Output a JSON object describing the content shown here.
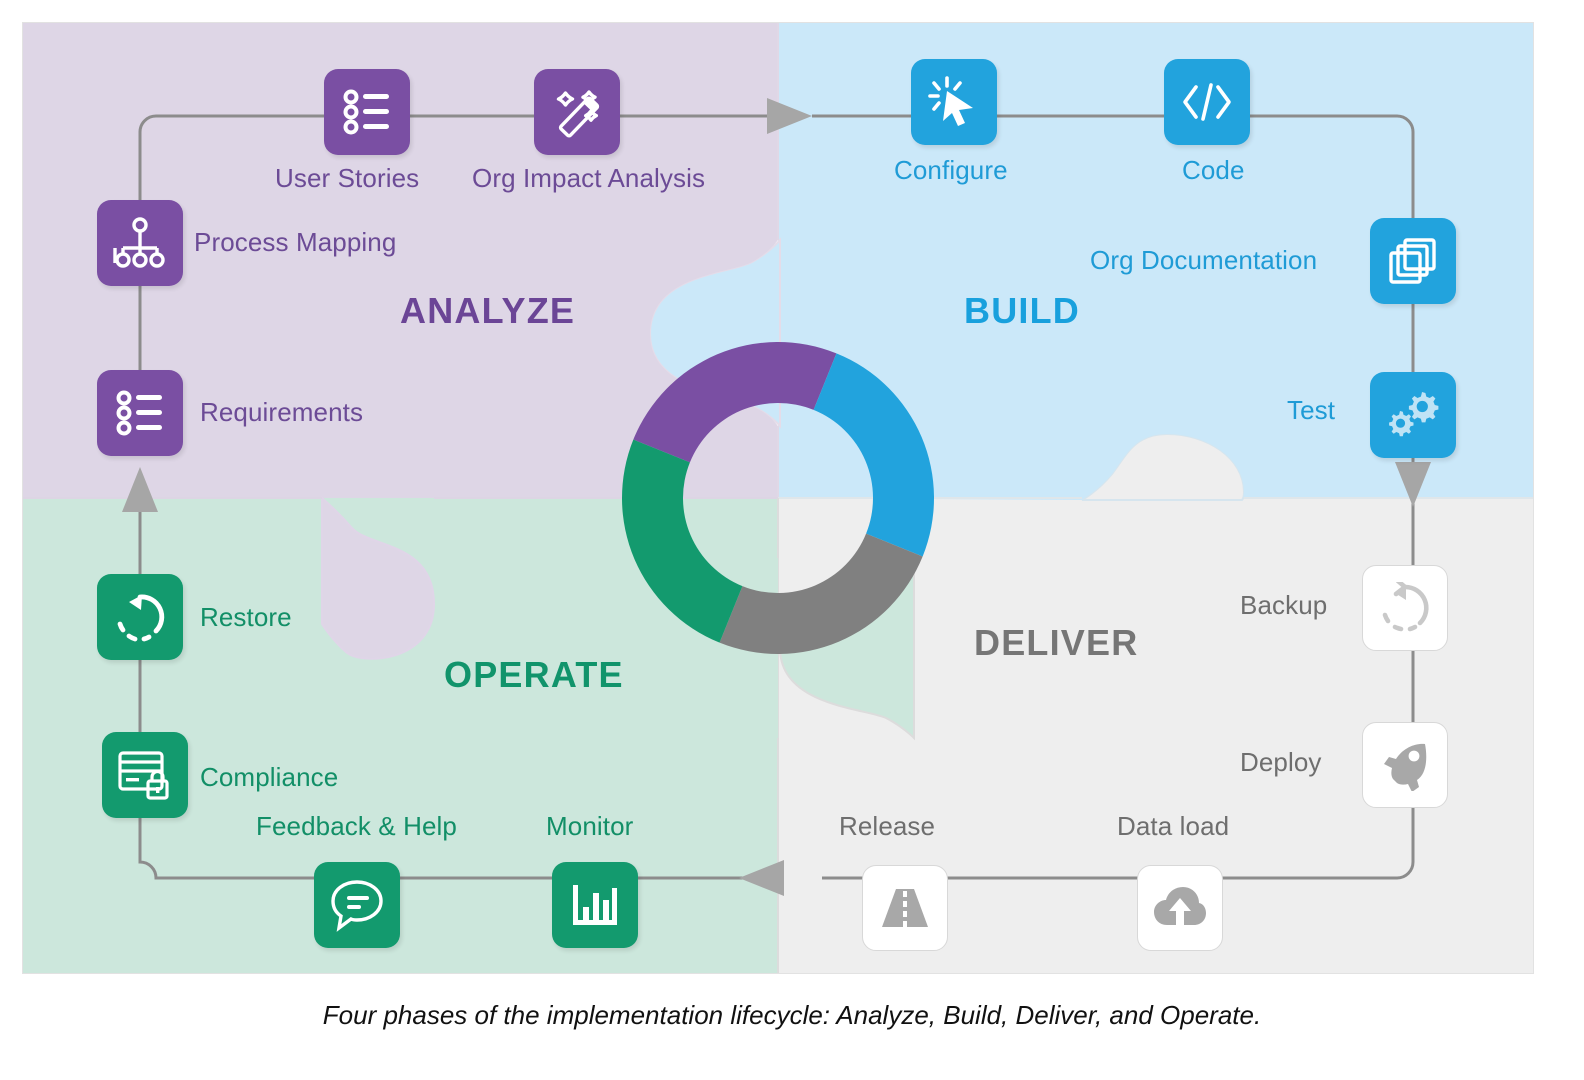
{
  "caption": "Four phases of the implementation lifecycle: Analyze, Build, Deliver, and Operate.",
  "phases": [
    {
      "key": "analyze",
      "title": "ANALYZE",
      "color": "#6b4596",
      "tile_color": "#7a4fa3",
      "background": "#ded6e6",
      "steps": [
        {
          "label": "User  Stories",
          "icon": "bulleted-list-icon"
        },
        {
          "label": "Org Impact Analysis",
          "icon": "magic-wand-icon"
        },
        {
          "label": "Process Mapping",
          "icon": "org-chart-icon"
        },
        {
          "label": "Requirements",
          "icon": "bulleted-list-icon"
        }
      ]
    },
    {
      "key": "build",
      "title": "BUILD",
      "color": "#18a0dd",
      "tile_color": "#22a3dd",
      "background": "#cbe8f9",
      "steps": [
        {
          "label": "Configure",
          "icon": "click-cursor-icon"
        },
        {
          "label": "Code",
          "icon": "code-brackets-icon"
        },
        {
          "label": "Org Documentation",
          "icon": "stacked-cards-icon"
        },
        {
          "label": "Test",
          "icon": "gears-icon"
        }
      ]
    },
    {
      "key": "deliver",
      "title": "DELIVER",
      "color": "#767676",
      "tile_color": "#ffffff",
      "background": "#eeeeee",
      "steps": [
        {
          "label": "Backup",
          "icon": "restore-arrow-icon"
        },
        {
          "label": "Deploy",
          "icon": "rocket-icon"
        },
        {
          "label": "Data load",
          "icon": "cloud-upload-icon"
        },
        {
          "label": "Release",
          "icon": "road-icon"
        }
      ]
    },
    {
      "key": "operate",
      "title": "OPERATE",
      "color": "#11946b",
      "tile_color": "#139a6e",
      "background": "#cce7dc",
      "steps": [
        {
          "label": "Monitor",
          "icon": "bar-chart-icon"
        },
        {
          "label": "Feedback & Help",
          "icon": "speech-bubble-icon"
        },
        {
          "label": "Compliance",
          "icon": "card-lock-icon"
        },
        {
          "label": "Restore",
          "icon": "restore-arrow-icon"
        }
      ]
    }
  ],
  "chart_data": {
    "type": "pie",
    "title": "",
    "categories": [
      "Analyze",
      "Build",
      "Deliver",
      "Operate"
    ],
    "values": [
      25,
      25,
      25,
      25
    ],
    "colors": [
      "#7a4fa3",
      "#22a3dd",
      "#808080",
      "#139a6e"
    ],
    "donut": true,
    "inner_radius_ratio": 0.62,
    "start_angle": -68,
    "legend": "none"
  }
}
